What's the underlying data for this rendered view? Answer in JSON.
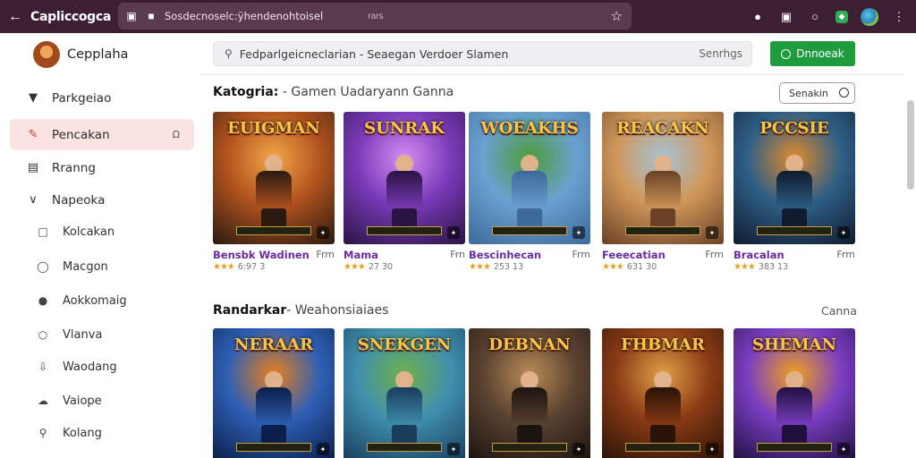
{
  "browser": {
    "site_title": "Capliccogca",
    "url_text": "Sosdecnoselc:ÿhendenohtoisel",
    "url_tail": "rars",
    "icons": [
      "back-arrow-icon",
      "tab-icon",
      "lock-icon",
      "star-icon",
      "puzzle-icon",
      "lens-icon",
      "circle-icon",
      "extension-icon",
      "avatar-icon",
      "kebab-icon"
    ]
  },
  "sidebar": {
    "brand_name": "Cepplaha",
    "items": [
      {
        "label": "Parkgeiao",
        "icon": "shield-icon"
      },
      {
        "label": "Pencakan",
        "icon": "pen-icon",
        "active": true,
        "trail": "headset-icon"
      },
      {
        "label": "Rranng",
        "icon": "box-icon"
      },
      {
        "label": "Napeoka",
        "icon": "chevron-down-icon"
      }
    ],
    "subitems": [
      {
        "label": "Kolcakan",
        "icon": "square-icon"
      },
      {
        "label": "Macgon",
        "icon": "chat-icon"
      },
      {
        "label": "Aokkomaig",
        "icon": "sun-icon"
      },
      {
        "label": "Vlanva",
        "icon": "circle-icon"
      },
      {
        "label": "Waodang",
        "icon": "download-icon"
      },
      {
        "label": "Vaiope",
        "icon": "cloud-icon"
      },
      {
        "label": "Kolang",
        "icon": "user-icon"
      }
    ]
  },
  "header": {
    "search_text": "Fedparlgeicneclarian  -  Seaegan  Verdoer  Slamen",
    "search_hint": "Senrhgs",
    "cta_label": "Dnnoeak"
  },
  "section1": {
    "title": "Katogria:",
    "subtitle": " -  Gamen  Uadaryann  Ganna",
    "button_label": "Senakin",
    "cards": [
      {
        "art_title": "EUIGMAN",
        "name": "Bensbk Wadinen",
        "meta": "Frm",
        "stars": "★★★",
        "rating": "6:97 3",
        "palette": [
          "#2b1a10",
          "#b2531e",
          "#f2a64a"
        ]
      },
      {
        "art_title": "SUNRAK",
        "name": "Mama",
        "meta": "Frn",
        "stars": "★★★",
        "rating": "27 30",
        "palette": [
          "#2a1445",
          "#7a3ab8",
          "#d68ef5"
        ]
      },
      {
        "art_title": "WOEAKHS",
        "name": "Bescinhecan",
        "meta": "Frm",
        "stars": "★★★",
        "rating": "253 13",
        "palette": [
          "#3d6a9a",
          "#6aa1d0",
          "#4c9c3a"
        ]
      },
      {
        "art_title": "REACAKN",
        "name": "Feeecatian",
        "meta": "Frm",
        "stars": "★★★",
        "rating": "631 30",
        "palette": [
          "#6a4125",
          "#d0975a",
          "#a5c3d8"
        ]
      },
      {
        "art_title": "PCCSIE",
        "name": "Bracalan",
        "meta": "Frm",
        "stars": "★★★",
        "rating": "383 13",
        "palette": [
          "#0f1b2e",
          "#2f5f86",
          "#e08a2c"
        ]
      }
    ]
  },
  "section2": {
    "title": "Randarkar",
    "subtitle": "-  Weahonsiaiaes",
    "link_label": "Canna",
    "cards": [
      {
        "art_title": "NERAAR",
        "palette": [
          "#0b1f4a",
          "#2e5fb5",
          "#e7801d"
        ]
      },
      {
        "art_title": "SNEKGEN",
        "palette": [
          "#1a3d5c",
          "#3f8fae",
          "#6fb04a"
        ]
      },
      {
        "art_title": "DEBNAN",
        "palette": [
          "#1c1410",
          "#5a4231",
          "#b98b57"
        ]
      },
      {
        "art_title": "FHBMAR",
        "palette": [
          "#2a1208",
          "#8a3b15",
          "#e0a046"
        ]
      },
      {
        "art_title": "SHEMAN",
        "palette": [
          "#1f1040",
          "#7b3ec2",
          "#f0a11d"
        ]
      }
    ]
  }
}
